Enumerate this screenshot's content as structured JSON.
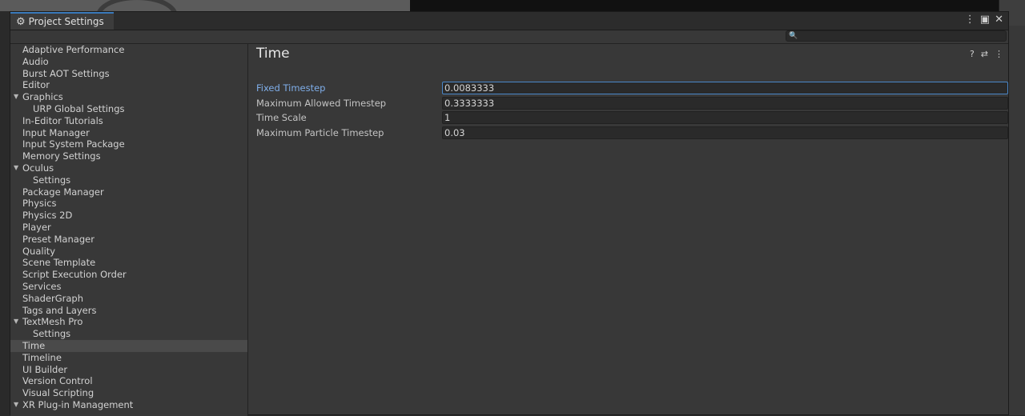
{
  "window": {
    "title": "Project Settings",
    "gear_icon": "⚙",
    "controls": {
      "more": "⋮",
      "maximize": "▣",
      "close": "✕"
    }
  },
  "search": {
    "placeholder": "",
    "value": ""
  },
  "sidebar": {
    "items": [
      {
        "label": "Adaptive Performance",
        "level": 0
      },
      {
        "label": "Audio",
        "level": 0
      },
      {
        "label": "Burst AOT Settings",
        "level": 0
      },
      {
        "label": "Editor",
        "level": 0
      },
      {
        "label": "Graphics",
        "level": 0,
        "expanded": true
      },
      {
        "label": "URP Global Settings",
        "level": 1
      },
      {
        "label": "In-Editor Tutorials",
        "level": 0
      },
      {
        "label": "Input Manager",
        "level": 0
      },
      {
        "label": "Input System Package",
        "level": 0
      },
      {
        "label": "Memory Settings",
        "level": 0
      },
      {
        "label": "Oculus",
        "level": 0,
        "expanded": true
      },
      {
        "label": "Settings",
        "level": 1
      },
      {
        "label": "Package Manager",
        "level": 0
      },
      {
        "label": "Physics",
        "level": 0
      },
      {
        "label": "Physics 2D",
        "level": 0
      },
      {
        "label": "Player",
        "level": 0
      },
      {
        "label": "Preset Manager",
        "level": 0
      },
      {
        "label": "Quality",
        "level": 0
      },
      {
        "label": "Scene Template",
        "level": 0
      },
      {
        "label": "Script Execution Order",
        "level": 0
      },
      {
        "label": "Services",
        "level": 0
      },
      {
        "label": "ShaderGraph",
        "level": 0
      },
      {
        "label": "Tags and Layers",
        "level": 0
      },
      {
        "label": "TextMesh Pro",
        "level": 0,
        "expanded": true
      },
      {
        "label": "Settings",
        "level": 1
      },
      {
        "label": "Time",
        "level": 0,
        "selected": true
      },
      {
        "label": "Timeline",
        "level": 0
      },
      {
        "label": "UI Builder",
        "level": 0
      },
      {
        "label": "Version Control",
        "level": 0
      },
      {
        "label": "Visual Scripting",
        "level": 0
      },
      {
        "label": "XR Plug-in Management",
        "level": 0,
        "expanded": true
      }
    ]
  },
  "content": {
    "title": "Time",
    "header_icons": {
      "help": "?",
      "presets": "⇄",
      "menu": "⋮"
    },
    "fields": [
      {
        "label": "Fixed Timestep",
        "value": "0.0083333",
        "focused": true
      },
      {
        "label": "Maximum Allowed Timestep",
        "value": "0.3333333"
      },
      {
        "label": "Time Scale",
        "value": "1"
      },
      {
        "label": "Maximum Particle Timestep",
        "value": "0.03"
      }
    ]
  },
  "colors": {
    "accent": "#3a79bb",
    "active_label": "#7faee9",
    "selected_row": "#4a4a4a"
  }
}
